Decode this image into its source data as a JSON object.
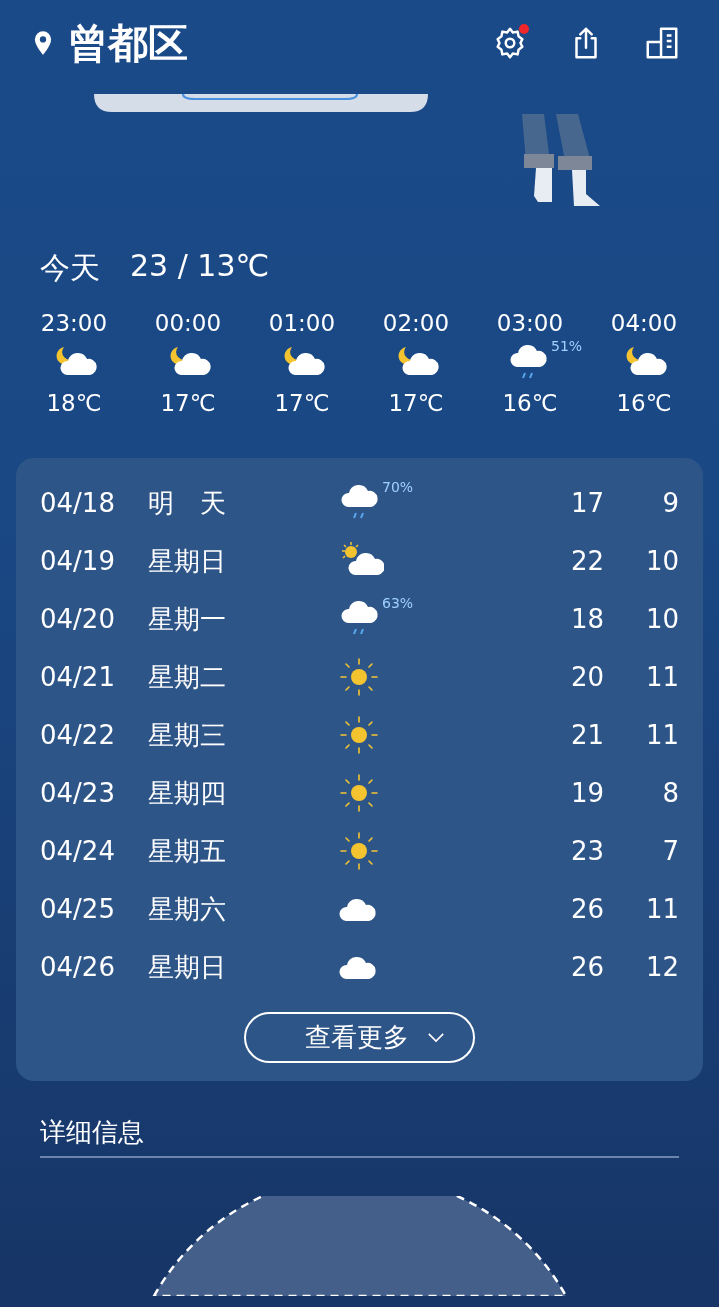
{
  "header": {
    "location": "曾都区",
    "settings_badge": true
  },
  "today": {
    "label": "今天",
    "range": "23 / 13℃"
  },
  "hourly": [
    {
      "time": "23:00",
      "kind": "moon-cloud",
      "temp": "18℃"
    },
    {
      "time": "00:00",
      "kind": "moon-cloud",
      "temp": "17℃"
    },
    {
      "time": "01:00",
      "kind": "moon-cloud",
      "temp": "17℃"
    },
    {
      "time": "02:00",
      "kind": "moon-cloud",
      "temp": "17℃"
    },
    {
      "time": "03:00",
      "kind": "rain",
      "precip": "51%",
      "temp": "16℃"
    },
    {
      "time": "04:00",
      "kind": "moon-cloud",
      "temp": "16℃"
    }
  ],
  "daily": [
    {
      "date": "04/18",
      "day": "明　天",
      "kind": "rain",
      "precip": "70%",
      "high": "17",
      "low": "9"
    },
    {
      "date": "04/19",
      "day": "星期日",
      "kind": "sun-cloud",
      "high": "22",
      "low": "10"
    },
    {
      "date": "04/20",
      "day": "星期一",
      "kind": "rain",
      "precip": "63%",
      "high": "18",
      "low": "10"
    },
    {
      "date": "04/21",
      "day": "星期二",
      "kind": "sun",
      "high": "20",
      "low": "11"
    },
    {
      "date": "04/22",
      "day": "星期三",
      "kind": "sun",
      "high": "21",
      "low": "11"
    },
    {
      "date": "04/23",
      "day": "星期四",
      "kind": "sun",
      "high": "19",
      "low": "8"
    },
    {
      "date": "04/24",
      "day": "星期五",
      "kind": "sun",
      "high": "23",
      "low": "7"
    },
    {
      "date": "04/25",
      "day": "星期六",
      "kind": "cloud",
      "high": "26",
      "low": "11"
    },
    {
      "date": "04/26",
      "day": "星期日",
      "kind": "cloud",
      "high": "26",
      "low": "12"
    }
  ],
  "more_button": "查看更多",
  "details": {
    "title": "详细信息"
  }
}
